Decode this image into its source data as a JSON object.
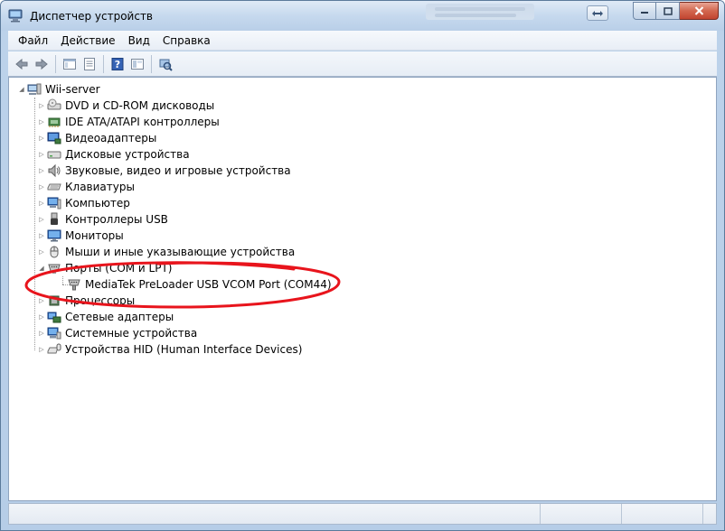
{
  "window": {
    "title": "Диспетчер устройств"
  },
  "menu": {
    "items": [
      "Файл",
      "Действие",
      "Вид",
      "Справка"
    ]
  },
  "toolbar": {
    "buttons": [
      "back-arrow-icon",
      "forward-arrow-icon",
      "show-hide-console-tree-icon",
      "properties-icon",
      "help-icon",
      "view-icon",
      "scan-hardware-icon"
    ]
  },
  "tree": {
    "root": "Wii-server",
    "categories": [
      {
        "label": "DVD и CD-ROM дисководы",
        "icon": "dvd-drive-icon"
      },
      {
        "label": "IDE ATA/ATAPI контроллеры",
        "icon": "ide-controller-icon"
      },
      {
        "label": "Видеоадаптеры",
        "icon": "display-adapter-icon"
      },
      {
        "label": "Дисковые устройства",
        "icon": "disk-drive-icon"
      },
      {
        "label": "Звуковые, видео и игровые устройства",
        "icon": "sound-icon"
      },
      {
        "label": "Клавиатуры",
        "icon": "keyboard-icon"
      },
      {
        "label": "Компьютер",
        "icon": "computer-icon"
      },
      {
        "label": "Контроллеры USB",
        "icon": "usb-controller-icon"
      },
      {
        "label": "Мониторы",
        "icon": "monitor-icon"
      },
      {
        "label": "Мыши и иные указывающие устройства",
        "icon": "mouse-icon"
      },
      {
        "label": "Порты (COM и LPT)",
        "icon": "port-icon",
        "expanded": true,
        "children": [
          {
            "label": "MediaTek PreLoader USB VCOM Port (COM44)",
            "icon": "serial-port-icon"
          }
        ]
      },
      {
        "label": "Процессоры",
        "icon": "processor-icon"
      },
      {
        "label": "Сетевые адаптеры",
        "icon": "network-adapter-icon"
      },
      {
        "label": "Системные устройства",
        "icon": "system-devices-icon"
      },
      {
        "label": "Устройства HID (Human Interface Devices)",
        "icon": "hid-icon"
      }
    ]
  },
  "colors": {
    "annotation": "#e8141c",
    "accent": "#1f5fbf"
  }
}
